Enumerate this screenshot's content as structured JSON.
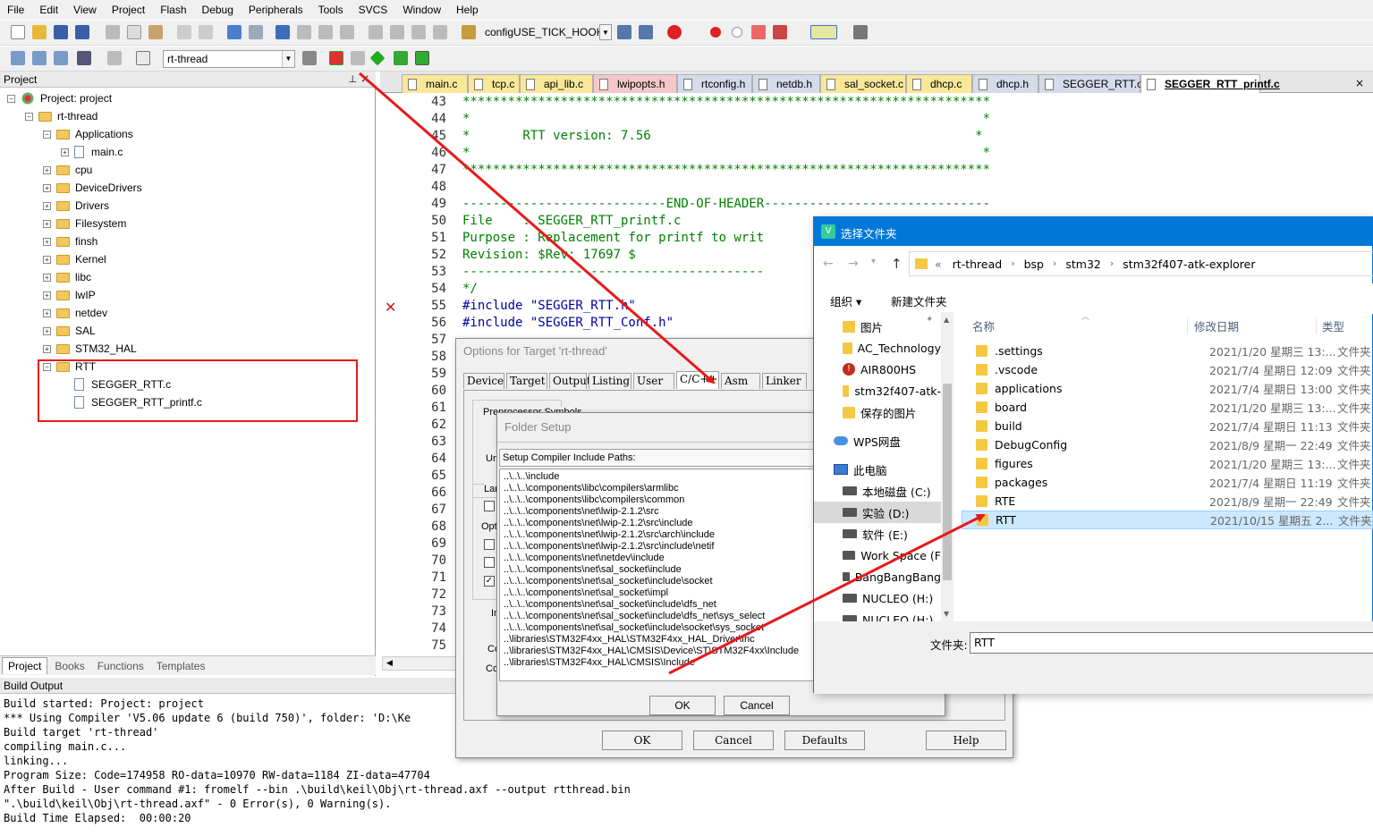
{
  "menu": [
    "File",
    "Edit",
    "View",
    "Project",
    "Flash",
    "Debug",
    "Peripherals",
    "Tools",
    "SVCS",
    "Window",
    "Help"
  ],
  "toolbar": {
    "find_text": "configUSE_TICK_HOOK",
    "target": "rt-thread"
  },
  "project_panel": {
    "title": "Project",
    "tree": [
      {
        "label": "Project: project",
        "level": 0,
        "kind": "project"
      },
      {
        "label": "rt-thread",
        "level": 1,
        "kind": "folder"
      },
      {
        "label": "Applications",
        "level": 2,
        "kind": "folder"
      },
      {
        "label": "main.c",
        "level": 3,
        "kind": "file"
      },
      {
        "label": "cpu",
        "level": 2,
        "kind": "folder"
      },
      {
        "label": "DeviceDrivers",
        "level": 2,
        "kind": "folder"
      },
      {
        "label": "Drivers",
        "level": 2,
        "kind": "folder"
      },
      {
        "label": "Filesystem",
        "level": 2,
        "kind": "folder"
      },
      {
        "label": "finsh",
        "level": 2,
        "kind": "folder"
      },
      {
        "label": "Kernel",
        "level": 2,
        "kind": "folder"
      },
      {
        "label": "libc",
        "level": 2,
        "kind": "folder"
      },
      {
        "label": "lwIP",
        "level": 2,
        "kind": "folder"
      },
      {
        "label": "netdev",
        "level": 2,
        "kind": "folder"
      },
      {
        "label": "SAL",
        "level": 2,
        "kind": "folder"
      },
      {
        "label": "STM32_HAL",
        "level": 2,
        "kind": "folder"
      },
      {
        "label": "RTT",
        "level": 2,
        "kind": "folder"
      },
      {
        "label": "SEGGER_RTT.c",
        "level": 3,
        "kind": "file"
      },
      {
        "label": "SEGGER_RTT_printf.c",
        "level": 3,
        "kind": "file"
      }
    ],
    "tabs": [
      "Project",
      "Books",
      "Functions",
      "Templates"
    ]
  },
  "file_tabs": [
    {
      "label": "main.c",
      "kind": "c"
    },
    {
      "label": "tcp.c",
      "kind": "c"
    },
    {
      "label": "api_lib.c",
      "kind": "c"
    },
    {
      "label": "lwipopts.h",
      "kind": "hp"
    },
    {
      "label": "rtconfig.h",
      "kind": "h"
    },
    {
      "label": "netdb.h",
      "kind": "h"
    },
    {
      "label": "sal_socket.c",
      "kind": "c"
    },
    {
      "label": "dhcp.c",
      "kind": "c"
    },
    {
      "label": "dhcp.h",
      "kind": "h"
    },
    {
      "label": "SEGGER_RTT.c",
      "kind": "h"
    },
    {
      "label": "SEGGER_RTT_printf.c",
      "kind": "active"
    }
  ],
  "editor": {
    "line_numbers": [
      "43",
      "44",
      "45",
      "46",
      "47",
      "48",
      "49",
      "50",
      "51",
      "52",
      "53",
      "54",
      "55",
      "56",
      "57",
      "58",
      "59",
      "60",
      "61",
      "62",
      "63",
      "64",
      "65",
      "66",
      "67",
      "68",
      "69",
      "70",
      "71",
      "72",
      "73",
      "74",
      "75"
    ],
    "lines": [
      {
        "text": "**********************************************************************",
        "cls": ""
      },
      {
        "text": "*                                                                    *",
        "cls": ""
      },
      {
        "text": "*       RTT version: 7.56                                           *",
        "cls": ""
      },
      {
        "text": "*                                                                    *",
        "cls": ""
      },
      {
        "text": "**********************************************************************",
        "cls": ""
      },
      {
        "text": "",
        "cls": ""
      },
      {
        "text": "---------------------------END-OF-HEADER------------------------------",
        "cls": ""
      },
      {
        "text": "File    : SEGGER_RTT_printf.c",
        "cls": ""
      },
      {
        "text": "Purpose : Replacement for printf to writ",
        "cls": ""
      },
      {
        "text": "Revision: $Rev: 17697 $",
        "cls": ""
      },
      {
        "text": "----------------------------------------",
        "cls": ""
      },
      {
        "text": "*/",
        "cls": ""
      },
      {
        "text": "#include \"SEGGER_RTT.h\"",
        "cls": "inc"
      },
      {
        "text": "#include \"SEGGER_RTT_Conf.h\"",
        "cls": "inc"
      }
    ],
    "error_marker": "✕"
  },
  "build_output": {
    "title": "Build Output",
    "lines": [
      "Build started: Project: project",
      "*** Using Compiler 'V5.06 update 6 (build 750)', folder: 'D:\\Ke",
      "Build target 'rt-thread'",
      "compiling main.c...",
      "linking...",
      "Program Size: Code=174958 RO-data=10970 RW-data=1184 ZI-data=47704",
      "After Build - User command #1: fromelf --bin .\\build\\keil\\Obj\\rt-thread.axf --output rtthread.bin",
      "\".\\build\\keil\\Obj\\rt-thread.axf\" - 0 Error(s), 0 Warning(s).",
      "Build Time Elapsed:  00:00:20"
    ]
  },
  "options_dialog": {
    "title": "Options for Target 'rt-thread'",
    "tabs": [
      "Device",
      "Target",
      "Output",
      "Listing",
      "User",
      "C/C++",
      "Asm",
      "Linker"
    ],
    "partial_labels": [
      "Preprocessor Symbols",
      "Un",
      "Lan",
      "Opt",
      "In",
      "Co",
      "Co"
    ],
    "buttons": {
      "ok": "OK",
      "cancel": "Cancel",
      "defaults": "Defaults",
      "help": "Help"
    }
  },
  "folder_setup": {
    "title": "Folder Setup",
    "list_label": "Setup Compiler Include Paths:",
    "paths": [
      "..\\..\\..\\include",
      "..\\..\\..\\components\\libc\\compilers\\armlibc",
      "..\\..\\..\\components\\libc\\compilers\\common",
      "..\\..\\..\\components\\net\\lwip-2.1.2\\src",
      "..\\..\\..\\components\\net\\lwip-2.1.2\\src\\include",
      "..\\..\\..\\components\\net\\lwip-2.1.2\\src\\arch\\include",
      "..\\..\\..\\components\\net\\lwip-2.1.2\\src\\include\\netif",
      "..\\..\\..\\components\\net\\netdev\\include",
      "..\\..\\..\\components\\net\\sal_socket\\include",
      "..\\..\\..\\components\\net\\sal_socket\\include\\socket",
      "..\\..\\..\\components\\net\\sal_socket\\impl",
      "..\\..\\..\\components\\net\\sal_socket\\include\\dfs_net",
      "..\\..\\..\\components\\net\\sal_socket\\include\\dfs_net\\sys_select",
      "..\\..\\..\\components\\net\\sal_socket\\include\\socket\\sys_socket",
      "..\\libraries\\STM32F4xx_HAL\\STM32F4xx_HAL_Driver\\Inc",
      "..\\libraries\\STM32F4xx_HAL\\CMSIS\\Device\\ST\\STM32F4xx\\Include",
      "..\\libraries\\STM32F4xx_HAL\\CMSIS\\Include"
    ],
    "buttons": {
      "ok": "OK",
      "cancel": "Cancel"
    }
  },
  "folder_picker": {
    "title": "选择文件夹",
    "breadcrumb": [
      "«",
      "rt-thread",
      "bsp",
      "stm32",
      "stm32f407-atk-explorer"
    ],
    "organize": "组织 ▾",
    "new_folder": "新建文件夹",
    "sidebar": [
      {
        "label": "图片",
        "kind": "folder"
      },
      {
        "label": "AC_Technology",
        "kind": "folder"
      },
      {
        "label": "AIR800HS",
        "kind": "error"
      },
      {
        "label": "stm32f407-atk-",
        "kind": "folder"
      },
      {
        "label": "保存的图片",
        "kind": "folder"
      },
      {
        "label": "WPS网盘",
        "kind": "cloud"
      },
      {
        "label": "此电脑",
        "kind": "pc"
      },
      {
        "label": "本地磁盘 (C:)",
        "kind": "drive"
      },
      {
        "label": "实验 (D:)",
        "kind": "drive"
      },
      {
        "label": "软件 (E:)",
        "kind": "drive"
      },
      {
        "label": "Work Space (F",
        "kind": "drive"
      },
      {
        "label": "BangBangBang",
        "kind": "drive"
      },
      {
        "label": "NUCLEO (H:)",
        "kind": "drive"
      },
      {
        "label": "NUCLEO (H:)",
        "kind": "drive"
      }
    ],
    "columns": {
      "name": "名称",
      "date": "修改日期",
      "type": "类型"
    },
    "rows": [
      {
        "name": ".settings",
        "date": "2021/1/20 星期三 13:...",
        "type": "文件夹"
      },
      {
        "name": ".vscode",
        "date": "2021/7/4 星期日 12:09",
        "type": "文件夹"
      },
      {
        "name": "applications",
        "date": "2021/7/4 星期日 13:00",
        "type": "文件夹"
      },
      {
        "name": "board",
        "date": "2021/1/20 星期三 13:...",
        "type": "文件夹"
      },
      {
        "name": "build",
        "date": "2021/7/4 星期日 11:13",
        "type": "文件夹"
      },
      {
        "name": "DebugConfig",
        "date": "2021/8/9 星期一 22:49",
        "type": "文件夹"
      },
      {
        "name": "figures",
        "date": "2021/1/20 星期三 13:...",
        "type": "文件夹"
      },
      {
        "name": "packages",
        "date": "2021/7/4 星期日 11:19",
        "type": "文件夹"
      },
      {
        "name": "RTE",
        "date": "2021/8/9 星期一 22:49",
        "type": "文件夹"
      },
      {
        "name": "RTT",
        "date": "2021/10/15 星期五 2...",
        "type": "文件夹"
      }
    ],
    "folder_label": "文件夹:",
    "folder_value": "RTT"
  },
  "colors": {
    "accent_blue": "#0078d7",
    "annotation_red": "#e8191a",
    "comment_green": "#008000"
  }
}
